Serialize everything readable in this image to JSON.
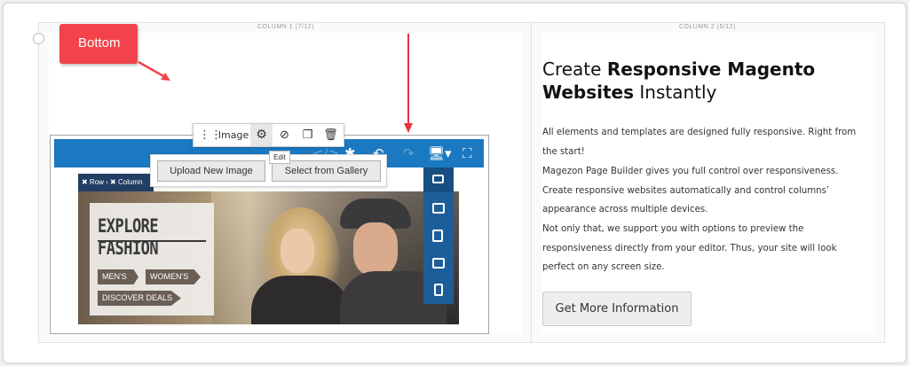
{
  "columns": {
    "col1_label": "COLUMN 1 (7/12)",
    "col2_label": "COLUMN 2 (5/12)"
  },
  "callout": {
    "text": "Bottom",
    "color": "#f2434b"
  },
  "element_toolbar": {
    "drag_icon": "drag-handle-icon",
    "label": "Image",
    "settings_icon": "gear-icon",
    "hide_icon": "eye-slash-icon",
    "duplicate_icon": "copy-icon",
    "delete_icon": "trash-icon",
    "tooltip": "Edit"
  },
  "image_controls": {
    "upload_label": "Upload New Image",
    "gallery_label": "Select from Gallery"
  },
  "breadcrumb": {
    "text": "✖ Row  ›  ✖ Column"
  },
  "editor_bar": {
    "color": "#1b79c2",
    "icons": [
      "undo-icon",
      "redo-icon",
      "desktop-device-icon",
      "fullscreen-icon"
    ]
  },
  "device_bar": {
    "icons": [
      "desktop-icon",
      "laptop-icon",
      "tablet-landscape-icon",
      "tablet-portrait-icon",
      "mobile-icon"
    ]
  },
  "hero_image": {
    "title": "EXPLORE FASHION",
    "tags": [
      "MEN'S",
      "WOMEN'S",
      "DISCOVER DEALS"
    ]
  },
  "content": {
    "heading_part1": "Create ",
    "heading_bold1": "Responsive Magento",
    "heading_bold2": "Websites",
    "heading_part2": " Instantly",
    "paragraph1": "All elements and templates are designed fully responsive. Right from the start!",
    "paragraph2": "Magezon Page Builder gives you full control over responsiveness. Create responsive websites automatically and control columns’ appearance across multiple devices.",
    "paragraph3": "Not only that, we support you with options to preview the responsiveness directly from your editor. Thus, your site will look perfect on any screen size.",
    "cta_label": "Get More Information"
  }
}
